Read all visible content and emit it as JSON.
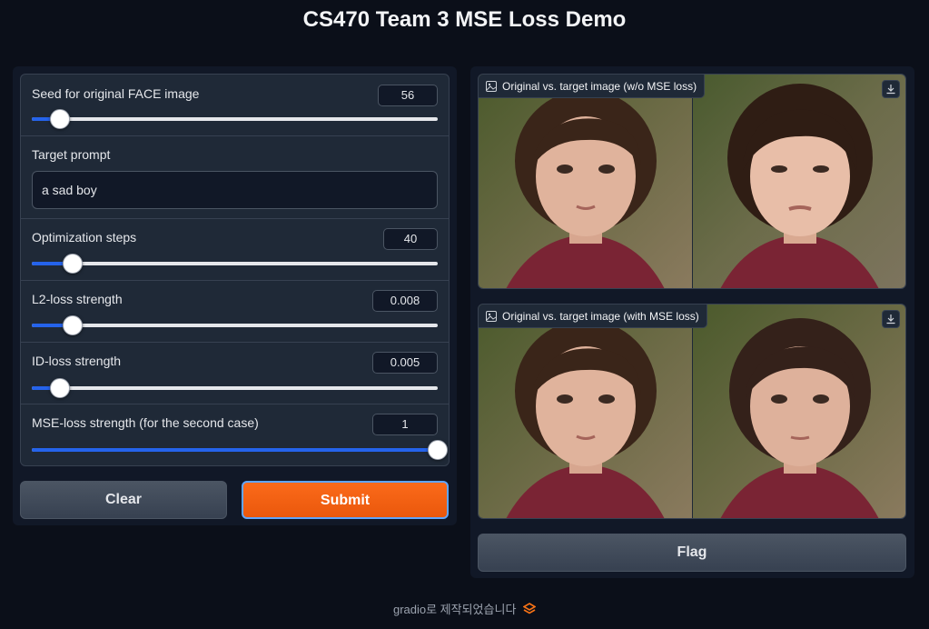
{
  "title": "CS470 Team 3 MSE Loss Demo",
  "controls": {
    "seed": {
      "label": "Seed for original FACE image",
      "value": "56",
      "fraction": 0.07
    },
    "prompt": {
      "label": "Target prompt",
      "value": "a sad boy"
    },
    "steps": {
      "label": "Optimization steps",
      "value": "40",
      "fraction": 0.1
    },
    "l2": {
      "label": "L2-loss strength",
      "value": "0.008",
      "fraction": 0.1
    },
    "id": {
      "label": "ID-loss strength",
      "value": "0.005",
      "fraction": 0.07
    },
    "mse": {
      "label": "MSE-loss strength (for the second case)",
      "value": "1",
      "fraction": 1.0
    }
  },
  "buttons": {
    "clear": "Clear",
    "submit": "Submit",
    "flag": "Flag"
  },
  "outputs": {
    "first": {
      "label": "Original vs. target image (w/o MSE loss)",
      "icon": "image-icon"
    },
    "second": {
      "label": "Original vs. target image (with MSE loss)",
      "icon": "image-icon"
    }
  },
  "footer": {
    "text": "gradio로 제작되었습니다",
    "logo": "gradio-logo"
  },
  "colors": {
    "background": "#0b0f19",
    "panel": "#111827",
    "block": "#1f2937",
    "accent": "#2563eb",
    "submit": "#ea580c"
  }
}
